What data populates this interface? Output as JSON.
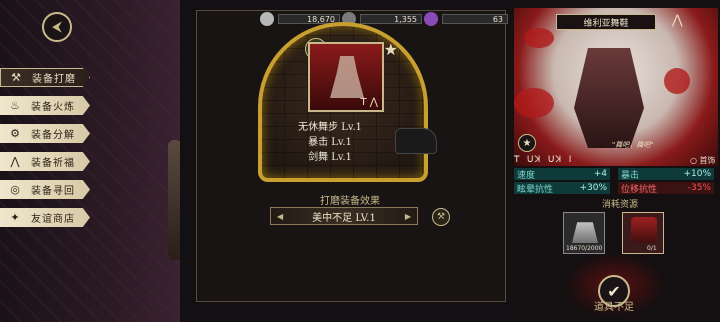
{
  "sidebar": {
    "items": [
      {
        "label": "装备打磨",
        "icon": "hammer-icon",
        "glyph": "⚒",
        "active": true
      },
      {
        "label": "装备火炼",
        "icon": "flame-icon",
        "glyph": "♨",
        "active": false
      },
      {
        "label": "装备分解",
        "icon": "disassemble-icon",
        "glyph": "⚙",
        "active": false
      },
      {
        "label": "装备祈福",
        "icon": "pray-icon",
        "glyph": "⋀",
        "active": false
      },
      {
        "label": "装备寻回",
        "icon": "retrieve-icon",
        "glyph": "◎",
        "active": false
      },
      {
        "label": "友谊商店",
        "icon": "fox-icon",
        "glyph": "✦",
        "active": false
      }
    ]
  },
  "resources": [
    {
      "name": "silver",
      "value": "18,670",
      "color": "#b8b8b8"
    },
    {
      "name": "iron-ore",
      "value": "1,355",
      "color": "#7a7a7a"
    },
    {
      "name": "crystal",
      "value": "63",
      "color": "#8a4ab8"
    }
  ],
  "forge": {
    "affixes": [
      "无休舞步 Lv.1",
      "暴击 Lv.1",
      "剑舞 Lv.1"
    ],
    "card_symbol": "T ⋀",
    "effect_title": "打磨装备效果",
    "effect_value": "美中不足 LV.1"
  },
  "item": {
    "name": "维利亚舞鞋",
    "quote": "\"舞吧，舞吧\"",
    "runes": "ꓔ ꓴꓘ ꓴꓘ ꓲ",
    "slot": "首饰",
    "stats": [
      {
        "label": "速度",
        "value": "+4",
        "type": "teal"
      },
      {
        "label": "暴击",
        "value": "+10%",
        "type": "teal"
      },
      {
        "label": "眩晕抗性",
        "value": "+30%",
        "type": "teal"
      },
      {
        "label": "位移抗性",
        "value": "-35%",
        "type": "red"
      }
    ],
    "cost_title": "消耗资源",
    "costs": [
      {
        "count": "18670/2000"
      },
      {
        "count": "0/1"
      }
    ],
    "status": "道具不足"
  }
}
